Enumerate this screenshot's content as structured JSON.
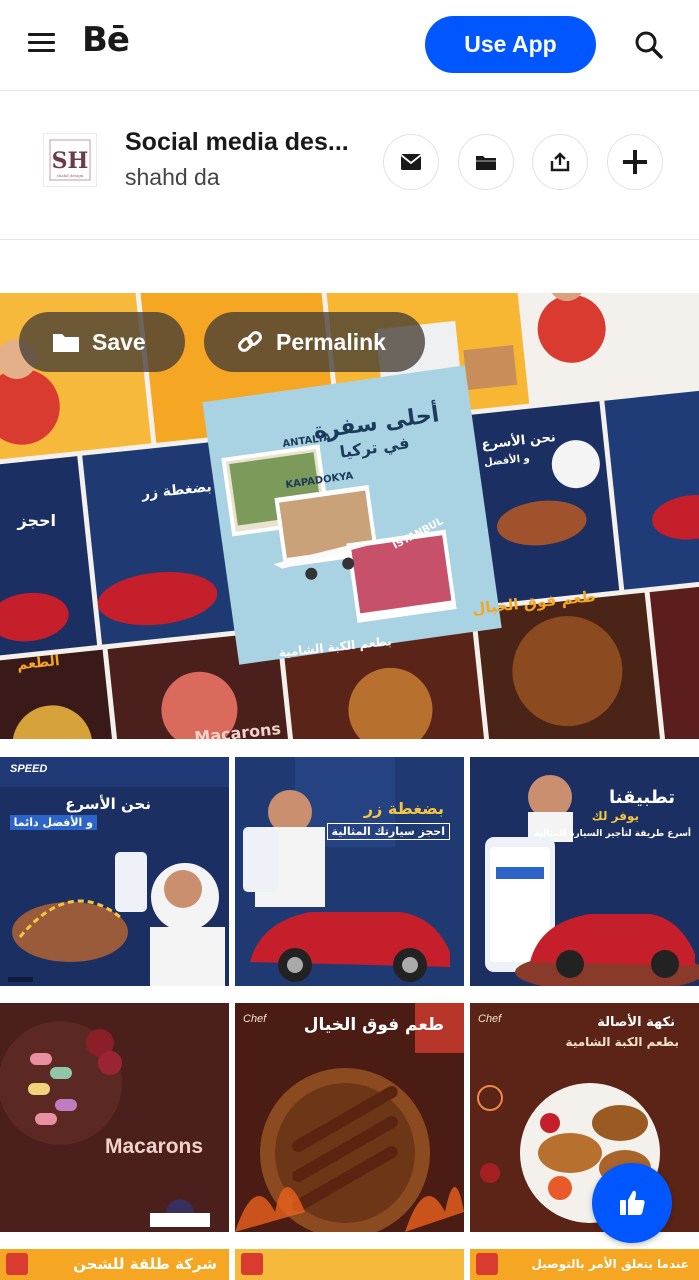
{
  "header": {
    "brand": "Bē",
    "use_app_label": "Use App",
    "icons": {
      "menu": "hamburger-icon",
      "search": "search-icon"
    }
  },
  "project": {
    "title": "Social media des...",
    "author": "shahd da",
    "actions": [
      "mail-icon",
      "folder-icon",
      "share-icon",
      "plus-icon"
    ]
  },
  "image_actions": {
    "save_label": "Save",
    "permalink_label": "Permalink"
  },
  "gallery": {
    "hero_text": {
      "travel_title": "أحلى سفرة",
      "travel_sub": "في تركيا",
      "antalya": "ANTALYA",
      "kapadokya": "KAPADOKYA",
      "istanbul": "ISTANBUL",
      "hajez": "احجز",
      "press": "بضغطة زر",
      "fastest": "نحن الأسرع",
      "best": "و الأفضل",
      "taste": "طعم فوق الخيال",
      "kubba": "بطعم الكبة الشامية",
      "taam": "الطعم",
      "macarons": "Macarons"
    },
    "row1": {
      "t1_a": "نحن الأسرع",
      "t1_b": "و الأفضل دائما",
      "t2_a": "بضغطة زر",
      "t2_b": "احجز سيارتك المثالية",
      "t3_a": "تطبيقنا",
      "t3_b": "يوفر لك",
      "t3_c": "أسرع طريقة لتأجير السيارة المثالية",
      "brand": "SPEED"
    },
    "row2": {
      "t1": "Macarons",
      "t2_a": "طعم فوق الخيال",
      "t3_a": "نكهة الأصالة",
      "t3_b": "بطعم الكبة الشامية",
      "chef": "Chef"
    },
    "row3": {
      "t1": "شركة طلقة للشحن",
      "t3": "عندما يتعلق الأمر بالتوصيل"
    }
  },
  "fab": {
    "icon": "thumbs-up-icon"
  },
  "colors": {
    "accent": "#0057ff",
    "navy": "#1b2f62",
    "food": "#4a1f1c",
    "orange": "#f5a623"
  }
}
